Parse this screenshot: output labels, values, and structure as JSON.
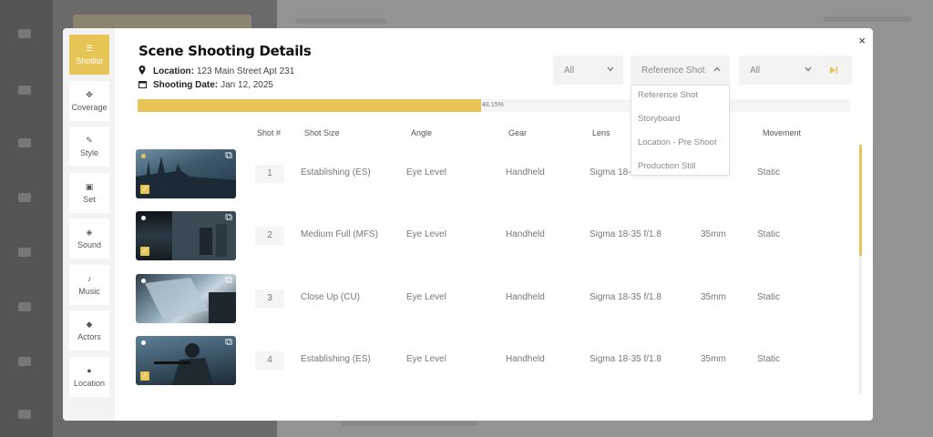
{
  "modal": {
    "title": "Scene Shooting Details",
    "close_icon": "×",
    "location_label": "Location:",
    "location_value": "123 Main Street Apt 231",
    "date_label": "Shooting Date:",
    "date_value": "Jan 12, 2025"
  },
  "nav": [
    {
      "label": "Shotlist",
      "icon": "☰",
      "active": true
    },
    {
      "label": "Coverage",
      "icon": "✥"
    },
    {
      "label": "Style",
      "icon": "✎"
    },
    {
      "label": "Set",
      "icon": "▣"
    },
    {
      "label": "Sound",
      "icon": "◈"
    },
    {
      "label": "Music",
      "icon": "♪"
    },
    {
      "label": "Actors",
      "icon": "◆"
    },
    {
      "label": "Location",
      "icon": "●"
    }
  ],
  "filters": {
    "filter1": "All",
    "filter2": "Reference Shot",
    "filter3": "All",
    "chevron_down": "⌄",
    "chevron_up": "⌃",
    "next_icon": "▶|"
  },
  "dropdown": {
    "options": [
      "Reference Shot",
      "Storyboard",
      "Location - Pre Shoot",
      "Production Still"
    ]
  },
  "progress": {
    "percent": 48.15,
    "label": "48.15%"
  },
  "columns": {
    "shot": "Shot #",
    "size": "Shot Size",
    "angle": "Angle",
    "gear": "Gear",
    "lens": "Lens",
    "movement": "Movement"
  },
  "rows": [
    {
      "num": "1",
      "size": "Establishing (ES)",
      "angle": "Eye Level",
      "gear": "Handheld",
      "lens": "Sigma 18-3",
      "focal": "",
      "movement": "Static",
      "dot_color": "#e7c456",
      "checked": true
    },
    {
      "num": "2",
      "size": "Medium Full (MFS)",
      "angle": "Eye Level",
      "gear": "Handheld",
      "lens": "Sigma 18-35 f/1.8",
      "focal": "35mm",
      "movement": "Static",
      "dot_color": "#ffffff",
      "checked": true
    },
    {
      "num": "3",
      "size": "Close Up (CU)",
      "angle": "Eye Level",
      "gear": "Handheld",
      "lens": "Sigma 18-35 f/1.8",
      "focal": "35mm",
      "movement": "Static",
      "dot_color": "#ffffff",
      "checked": false
    },
    {
      "num": "4",
      "size": "Establishing (ES)",
      "angle": "Eye Level",
      "gear": "Handheld",
      "lens": "Sigma 18-35 f/1.8",
      "focal": "35mm",
      "movement": "Static",
      "dot_color": "#ffffff",
      "checked": true
    }
  ],
  "icons": {
    "external": "⧉",
    "check": "✓",
    "pin": "⬤",
    "calendar": "▦"
  },
  "colors": {
    "accent": "#e7c456"
  }
}
